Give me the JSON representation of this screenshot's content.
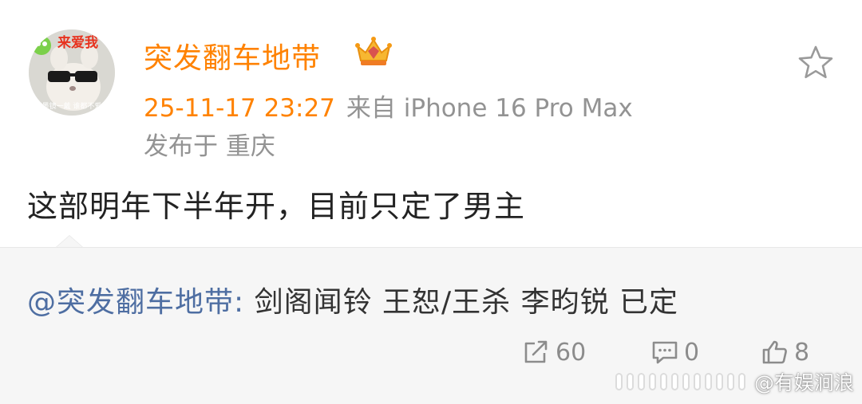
{
  "post": {
    "author_name": "突发翻车地带",
    "avatar_sticker_text": "来爱我",
    "avatar_caption": "墨镜一戴 谁都不爱",
    "timestamp": "25-11-17 23:27",
    "source": "来自 iPhone 16 Pro Max",
    "location": "发布于 重庆",
    "text": "这部明年下半年开，目前只定了男主",
    "icons": {
      "favorite": "star-outline-icon",
      "vip": "crown-vip-badge-icon"
    }
  },
  "repost": {
    "mention": "@突发翻车地带:",
    "text": " 剑阁闻铃 王恕/王杀 李昀锐 已定"
  },
  "actions": {
    "repost_count": "60",
    "comment_count": "0",
    "like_count": "8"
  },
  "watermark": {
    "text": "@有娱涧浪"
  },
  "colors": {
    "accent_orange": "#ff8200",
    "mention_blue": "#4e6ea2",
    "repost_bg": "#f6f6f6",
    "meta_gray": "#939393"
  }
}
